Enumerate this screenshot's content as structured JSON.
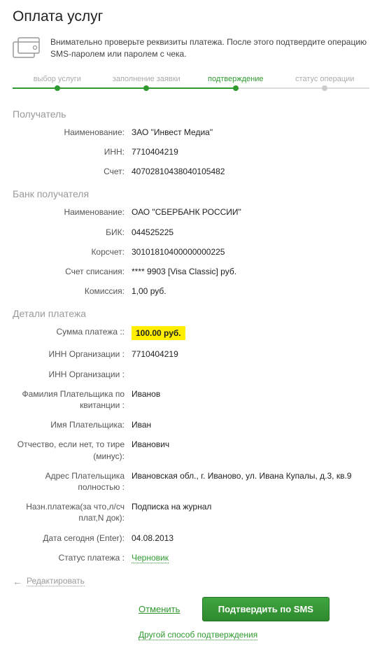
{
  "page_title": "Оплата услуг",
  "info_text": "Внимательно проверьте реквизиты платежа. После этого подтвердите операцию SMS-паролем или паролем с чека.",
  "steps": {
    "items": [
      "выбор услуги",
      "заполнение заявки",
      "подтверждение",
      "статус операции"
    ],
    "active_index": 2
  },
  "sections": {
    "recipient": {
      "title": "Получатель",
      "name_label": "Наименование:",
      "name_value": "ЗАО \"Инвест Медиа\"",
      "inn_label": "ИНН:",
      "inn_value": "7710404219",
      "account_label": "Счет:",
      "account_value": "40702810438040105482"
    },
    "bank": {
      "title": "Банк получателя",
      "name_label": "Наименование:",
      "name_value": "ОАО \"СБЕРБАНК РОССИИ\"",
      "bik_label": "БИК:",
      "bik_value": "044525225",
      "corr_label": "Корсчет:",
      "corr_value": "30101810400000000225",
      "writeoff_label": "Счет списания:",
      "writeoff_value": "**** 9903  [Visa Classic]  руб.",
      "commission_label": "Комиссия:",
      "commission_value": "1,00 руб."
    },
    "details": {
      "title": "Детали платежа",
      "amount_label": "Сумма платежа ::",
      "amount_value": "100.00 руб.",
      "org_inn_label": "ИНН Организации :",
      "org_inn_value": "7710404219",
      "org_inn2_label": "ИНН Организации :",
      "org_inn2_value": "",
      "surname_label": "Фамилия Плательщика по квитанции :",
      "surname_value": "Иванов",
      "firstname_label": "Имя Плательщика:",
      "firstname_value": "Иван",
      "patronymic_label": "Отчество, если нет, то тире (минус):",
      "patronymic_value": "Иванович",
      "address_label": "Адрес Плательщика полностью :",
      "address_value": "Ивановская обл., г. Иваново, ул. Ивана Купалы, д.3, кв.9",
      "purpose_label": "Назн.платежа(за что,л/сч плат,N док):",
      "purpose_value": "Подписка на журнал",
      "date_label": "Дата сегодня (Enter):",
      "date_value": "04.08.2013",
      "status_label": "Статус платежа :",
      "status_value": "Черновик"
    }
  },
  "footer": {
    "edit": "Редактировать",
    "cancel": "Отменить",
    "confirm": "Подтвердить по SMS",
    "alt_confirm": "Другой способ подтверждения"
  }
}
